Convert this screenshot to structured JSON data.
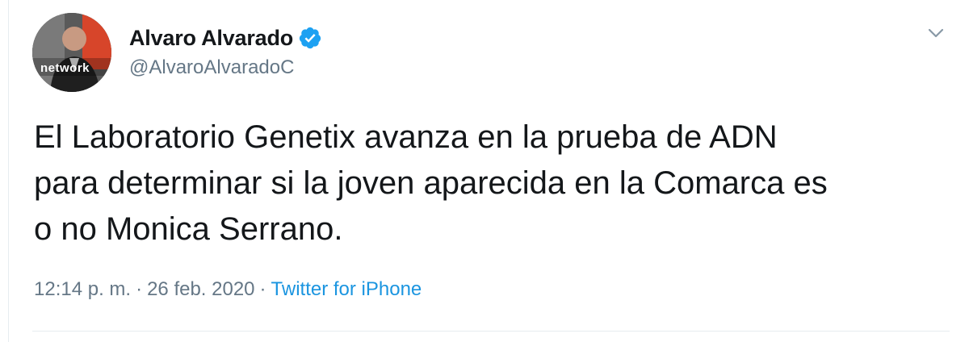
{
  "tweet": {
    "author": {
      "display_name": "Alvaro Alvarado",
      "handle": "@AlvaroAlvaradoC",
      "verified": true,
      "avatar_overlay_text": "network"
    },
    "text": "El Laboratorio Genetix avanza en la prueba de ADN\npara determinar si la joven aparecida en la Comarca es\no no Monica Serrano.",
    "meta": {
      "time": "12:14 p. m.",
      "separator": "·",
      "date": "26 feb. 2020",
      "source": "Twitter for iPhone"
    }
  },
  "icons": {
    "verified": "verified-badge-icon",
    "menu": "chevron-down-icon"
  },
  "colors": {
    "text_primary": "#14171a",
    "text_secondary": "#657786",
    "link": "#1b95e0",
    "verified_badge": "#1da1f2",
    "divider": "#e6ecf0"
  }
}
